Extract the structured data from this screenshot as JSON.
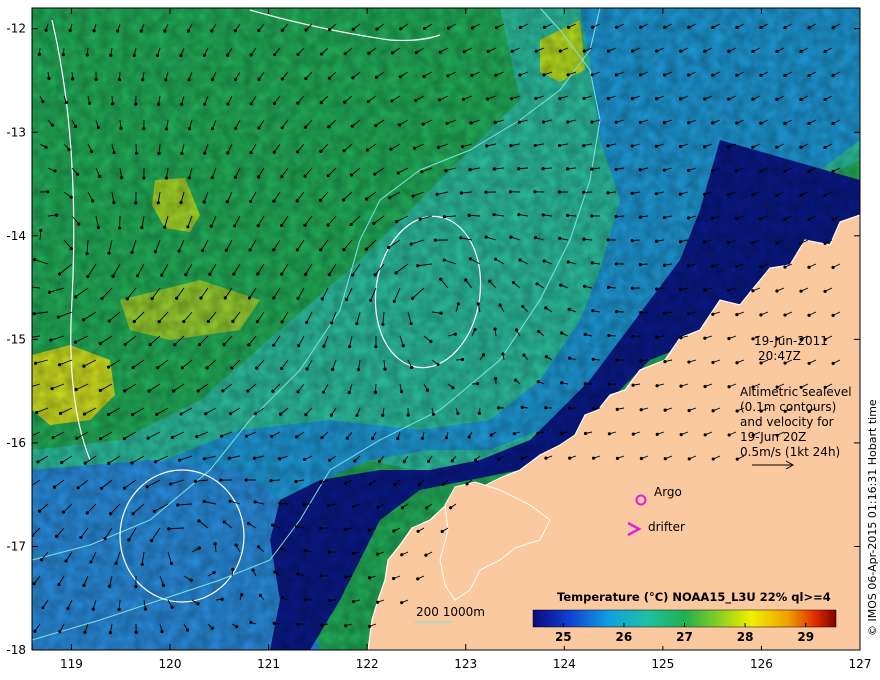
{
  "map": {
    "lon_range": [
      118.6,
      127
    ],
    "lat_range": [
      -18,
      -11.8
    ],
    "x_ticks": [
      119,
      120,
      121,
      122,
      123,
      124,
      125,
      126,
      127
    ],
    "y_ticks": [
      -12,
      -13,
      -14,
      -15,
      -16,
      -17,
      -18
    ],
    "x_tick_labels": [
      "119",
      "120",
      "121",
      "122",
      "123",
      "124",
      "125",
      "126",
      "127"
    ],
    "y_tick_labels": [
      "-12",
      "-13",
      "-14",
      "-15",
      "-16",
      "-17",
      "-18"
    ]
  },
  "annotations": {
    "date": "19-Jun-2011",
    "time": "20:47Z",
    "altimetry_lines": [
      "Altimetric sealevel",
      "(0.1m contours)",
      "and velocity for",
      "19-Jun 20Z",
      "0.5m/s (1kt 24h)"
    ],
    "argo_label": "Argo",
    "drifter_label": "drifter",
    "isobath_label": "200  1000m",
    "credit": "© IMOS 06-Apr-2015 01:16:31 Hobart time"
  },
  "legend": {
    "title": "Temperature (°C) NOAA15_L3U 22% ql>=4",
    "min": 24.5,
    "max": 29.5,
    "ticks": [
      25,
      26,
      27,
      28,
      29
    ],
    "tick_labels": [
      "25",
      "26",
      "27",
      "28",
      "29"
    ]
  },
  "colors": {
    "land": "#fbc9a0",
    "warm_water": "#22b05a",
    "cool_water": "#1e9ad8",
    "cold_water": "#0a1a8a",
    "contour": "#ffffff",
    "isobath": "#7fe0e0",
    "argo": "#e020e0",
    "arrow": "#000000"
  }
}
